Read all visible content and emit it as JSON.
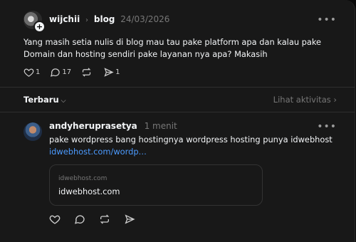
{
  "post": {
    "username": "wijchii",
    "separator": "›",
    "category": "blog",
    "date": "24/03/2026",
    "more": "•••",
    "text": "Yang masih setia nulis di blog mau tau pake platform apa dan kalau pake Domain dan hosting sendiri pake layanan nya apa? Makasih",
    "likes": "1",
    "comments": "17",
    "shares": "1"
  },
  "sort": {
    "label": "Terbaru",
    "chevron": "⌵",
    "activity": "Lihat aktivitas ›"
  },
  "reply": {
    "username": "andyheruprasetya",
    "time": "1 menit",
    "more": "•••",
    "text": "pake wordpress bang hostingnya wordpress hosting punya idwebhost",
    "link": "idwebhost.com/wordp…",
    "card_domain": "idwebhost.com",
    "card_title": "idwebhost.com"
  },
  "icons": {
    "like": "heart-icon",
    "comment": "comment-icon",
    "repost": "repost-icon",
    "share": "send-icon",
    "plus": "+"
  }
}
